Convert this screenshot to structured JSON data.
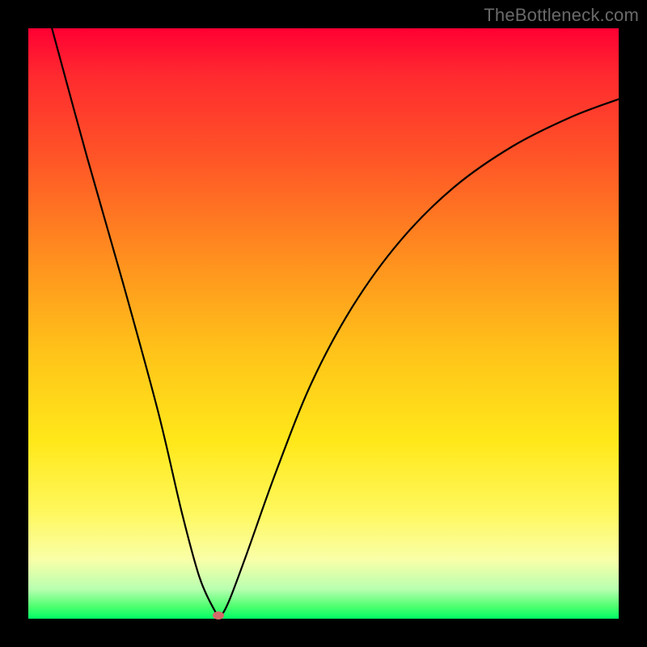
{
  "watermark": "TheBottleneck.com",
  "chart_data": {
    "type": "line",
    "title": "",
    "xlabel": "",
    "ylabel": "",
    "xlim": [
      0,
      100
    ],
    "ylim": [
      0,
      100
    ],
    "grid": false,
    "legend": false,
    "series": [
      {
        "name": "curve",
        "x": [
          4,
          10,
          16,
          22,
          26,
          29,
          31.5,
          32.5,
          34,
          37,
          42,
          48,
          55,
          63,
          72,
          82,
          92,
          100
        ],
        "values": [
          100,
          78,
          57,
          35,
          18,
          7,
          1.5,
          0.5,
          3,
          11,
          25,
          40,
          53,
          64,
          73,
          80,
          85,
          88
        ]
      }
    ],
    "marker": {
      "x": 32.2,
      "y": 0.6
    },
    "gradient_stops": [
      {
        "pos": 0,
        "color": "#ff0033"
      },
      {
        "pos": 22,
        "color": "#ff5527"
      },
      {
        "pos": 55,
        "color": "#ffc419"
      },
      {
        "pos": 82,
        "color": "#fff85e"
      },
      {
        "pos": 100,
        "color": "#00ff66"
      }
    ]
  }
}
